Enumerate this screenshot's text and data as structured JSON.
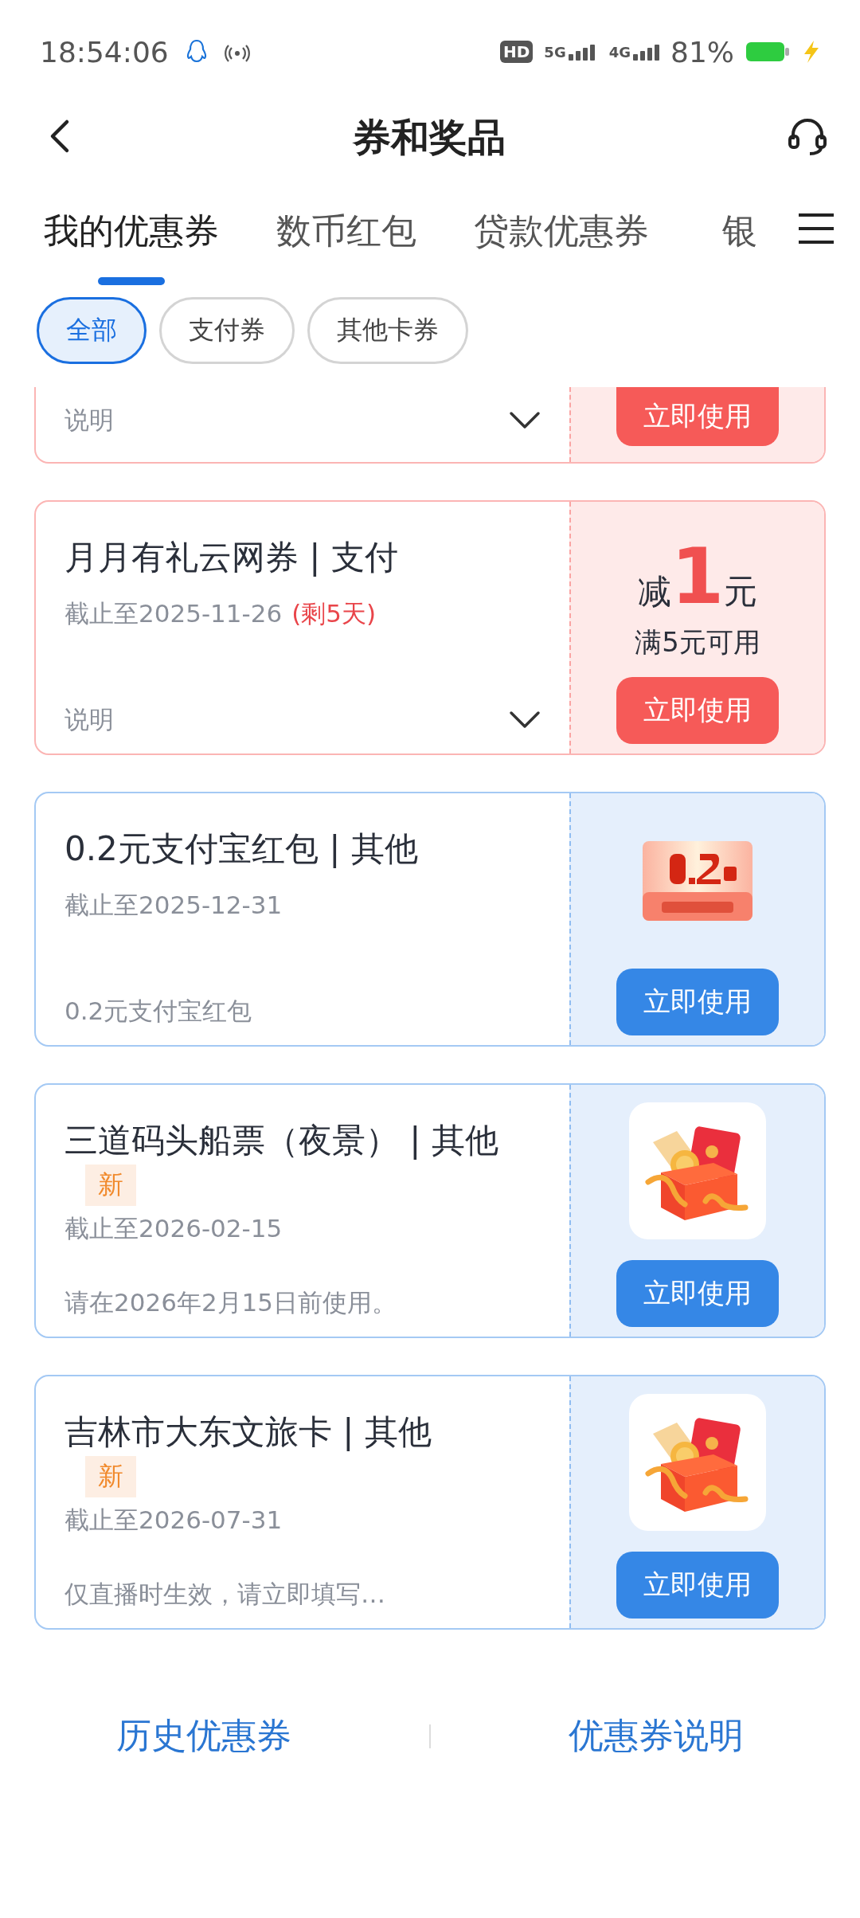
{
  "status_bar": {
    "time": "18:54:06",
    "hd": "HD",
    "networks": [
      "5G",
      "4G"
    ],
    "battery": "81%"
  },
  "header": {
    "title": "券和奖品"
  },
  "tabs": [
    {
      "label": "我的优惠券",
      "selected": true
    },
    {
      "label": "数币红包",
      "selected": false
    },
    {
      "label": "贷款优惠券",
      "selected": false
    },
    {
      "label": "银",
      "selected": false
    }
  ],
  "filters": [
    {
      "label": "全部",
      "selected": true
    },
    {
      "label": "支付券",
      "selected": false
    },
    {
      "label": "其他卡券",
      "selected": false
    }
  ],
  "coupons": [
    {
      "kind": "clipped",
      "color": "#f65a58",
      "description": "说明",
      "expanded": false,
      "button": "立即使用"
    },
    {
      "kind": "discount",
      "color": "#f65a58",
      "title": "月月有礼云网券 | 支付",
      "deadline": "截止至2025-11-26",
      "remaining": "(剩5天)",
      "description": "说明",
      "expanded": false,
      "prefix": "减",
      "amount": "1",
      "unit": "元",
      "condition": "满5元可用",
      "button": "立即使用"
    },
    {
      "kind": "ticket",
      "color": "#3587e6",
      "title": "0.2元支付宝红包 |  其他",
      "deadline": "截止至2025-12-31",
      "description": "0.2元支付宝红包",
      "button": "立即使用"
    },
    {
      "kind": "gift",
      "color": "#3587e6",
      "title": "三道码头船票（夜景） |  其他",
      "badge": "新",
      "deadline": "截止至2026-02-15",
      "description": "请在2026年2月15日前使用。",
      "button": "立即使用"
    },
    {
      "kind": "gift",
      "color": "#3587e6",
      "title": "吉林市大东文旅卡 |  其他",
      "badge": "新",
      "deadline": "截止至2026-07-31",
      "description": "仅直播时生效，请立即填写…",
      "button": "立即使用"
    }
  ],
  "footer": {
    "links": [
      "历史优惠券",
      "优惠券说明"
    ]
  }
}
